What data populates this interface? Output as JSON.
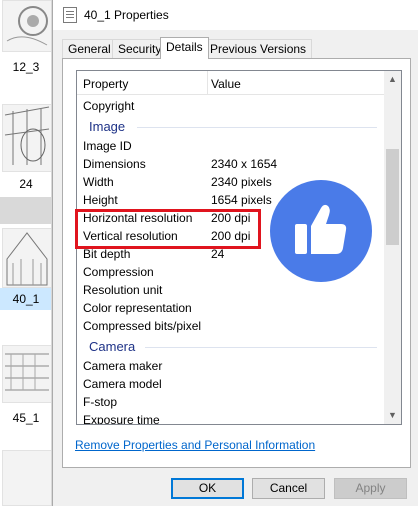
{
  "explorer": {
    "items": [
      {
        "label": "12_3"
      },
      {
        "label": "24"
      },
      {
        "label": "40_1"
      },
      {
        "label": "45_1"
      }
    ]
  },
  "window": {
    "title": "40_1 Properties",
    "tabs": [
      {
        "label": "General"
      },
      {
        "label": "Security"
      },
      {
        "label": "Details"
      },
      {
        "label": "Previous Versions"
      }
    ],
    "active_tab": "Details"
  },
  "details": {
    "columns": {
      "property": "Property",
      "value": "Value"
    },
    "rows_top": [
      {
        "property": "Copyright",
        "value": ""
      }
    ],
    "group_image": "Image",
    "image_rows": [
      {
        "property": "Image ID",
        "value": ""
      },
      {
        "property": "Dimensions",
        "value": "2340 x 1654"
      },
      {
        "property": "Width",
        "value": "2340 pixels"
      },
      {
        "property": "Height",
        "value": "1654 pixels"
      },
      {
        "property": "Horizontal resolution",
        "value": "200 dpi"
      },
      {
        "property": "Vertical resolution",
        "value": "200 dpi"
      },
      {
        "property": "Bit depth",
        "value": "24"
      },
      {
        "property": "Compression",
        "value": ""
      },
      {
        "property": "Resolution unit",
        "value": ""
      },
      {
        "property": "Color representation",
        "value": ""
      },
      {
        "property": "Compressed bits/pixel",
        "value": ""
      }
    ],
    "group_camera": "Camera",
    "camera_rows": [
      {
        "property": "Camera maker",
        "value": ""
      },
      {
        "property": "Camera model",
        "value": ""
      },
      {
        "property": "F-stop",
        "value": ""
      },
      {
        "property": "Exposure time",
        "value": ""
      }
    ],
    "highlighted_rows": [
      "Horizontal resolution",
      "Vertical resolution"
    ]
  },
  "remove_link": "Remove Properties and Personal Information",
  "buttons": {
    "ok": "OK",
    "cancel": "Cancel",
    "apply": "Apply"
  },
  "colors": {
    "highlight": "#e0141e",
    "like_badge": "#4a7be8",
    "link": "#0066cc"
  },
  "icons": {
    "title": "properties-icon",
    "overlay": "thumbs-up-icon"
  }
}
